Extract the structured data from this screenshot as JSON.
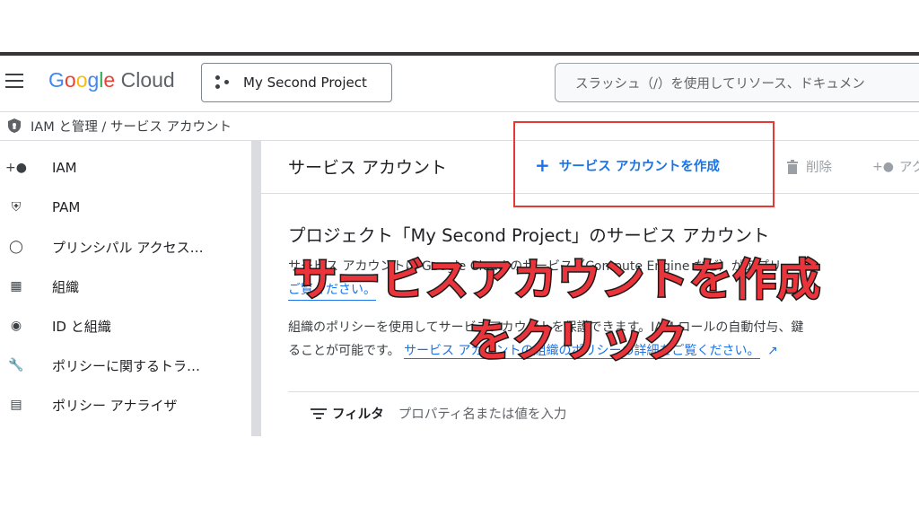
{
  "header": {
    "logo_text": "Google Cloud",
    "project_label": "My Second Project",
    "search_placeholder": "スラッシュ（/）を使用してリソース、ドキュメン"
  },
  "breadcrumb": {
    "text": "IAM と管理  /  サービス アカウント"
  },
  "sidebar": {
    "items": [
      {
        "label": "IAM",
        "icon": "person-add-icon"
      },
      {
        "label": "PAM",
        "icon": "shield-lock-icon"
      },
      {
        "label": "プリンシパル アクセス…",
        "icon": "policy-icon"
      },
      {
        "label": "組織",
        "icon": "building-icon"
      },
      {
        "label": "ID と組織",
        "icon": "account-circle-icon"
      },
      {
        "label": "ポリシーに関するトラ…",
        "icon": "wrench-icon"
      },
      {
        "label": "ポリシー アナライザ",
        "icon": "document-search-icon"
      }
    ]
  },
  "main": {
    "title": "サービス アカウント",
    "create_label": "サービス アカウントを作成",
    "delete_label": "削除",
    "access_label": "アク",
    "section_title": "プロジェクト「My Second Project」のサービス アカウント",
    "desc_line1": "サービス アカウントは Google Cloud のサービス（Compute Engine など）がアプリ",
    "desc_line1b": "ご覧ください。",
    "desc_line2": "組織のポリシーを使用してサービスアカウントを保護できます。IAM ロールの自動付与、鍵",
    "desc_line3_prefix": "ることが可能です。",
    "desc_line3_link": "サービス アカウントの組織のポリシーの詳細をご覧ください。",
    "filter_label": "フィルタ",
    "filter_placeholder": "プロパティ名または値を入力"
  },
  "annotation": {
    "line1": "サービスアカウントを作成",
    "line2": "をクリック",
    "color": "#e8343a"
  }
}
